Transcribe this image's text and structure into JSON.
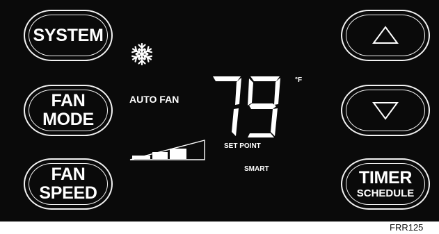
{
  "buttons": {
    "system": {
      "label": "SYSTEM"
    },
    "fan_mode": {
      "line1": "FAN",
      "line2": "MODE"
    },
    "fan_speed": {
      "line1": "FAN",
      "line2": "SPEED"
    },
    "up": {
      "icon": "triangle-up-icon"
    },
    "down": {
      "icon": "triangle-down-icon"
    },
    "timer_schedule": {
      "line1": "TIMER",
      "line2": "SCHEDULE"
    }
  },
  "display": {
    "mode_icon": "snowflake-icon",
    "fan_mode_text": "AUTO FAN",
    "temperature": "79",
    "unit": "°F",
    "set_point_label": "SET POINT",
    "smart_label": "SMART",
    "fan_speed_level": "3 of 3"
  },
  "footer": {
    "model": "FRR125"
  },
  "colors": {
    "panel": "#0a0a0a",
    "foreground": "#ffffff"
  }
}
